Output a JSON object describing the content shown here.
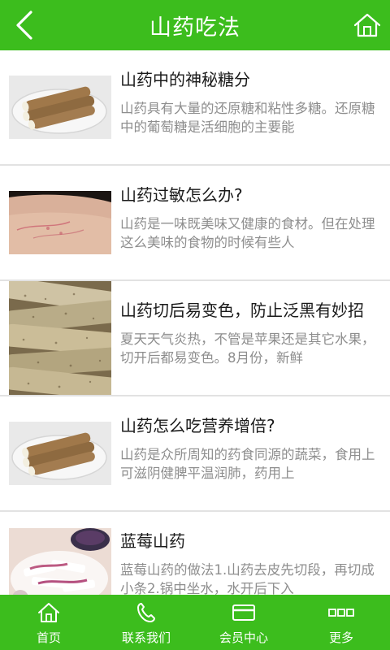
{
  "header": {
    "title": "山药吃法",
    "back_icon": "chevron-left-icon",
    "home_icon": "home-icon"
  },
  "colors": {
    "brand_green": "#3cbd1d",
    "title_text": "#1a1a1a",
    "desc_text": "#8e8e8e",
    "divider": "#e2e2e2"
  },
  "articles": [
    {
      "title": "山药中的神秘糖分",
      "desc": "山药具有大量的还原糖和粘性多糖。还原糖中的葡萄糖是活细胞的主要能",
      "image": "yam-on-plate"
    },
    {
      "title": "山药过敏怎么办?",
      "desc": "山药是一味既美味又健康的食材。但在处理这么美味的食物的时候有些人",
      "image": "allergic-skin"
    },
    {
      "title": "山药切后易变色，防止泛黑有妙招",
      "desc": "夏天天气炎热，不管是苹果还是其它水果，切开后都易变色。8月份，新鲜",
      "image": "yam-pile"
    },
    {
      "title": "山药怎么吃营养增倍?",
      "desc": "山药是众所周知的药食同源的蔬菜，食用上可滋阴健脾平温润肺，药用上",
      "image": "yam-on-plate"
    },
    {
      "title": "蓝莓山药",
      "desc": "蓝莓山药的做法1.山药去皮先切段，再切成小条2.锅中坐水，水开后下入",
      "image": "blueberry-yam-dish"
    }
  ],
  "bottom_nav": [
    {
      "label": "首页",
      "icon": "home-icon"
    },
    {
      "label": "联系我们",
      "icon": "phone-icon"
    },
    {
      "label": "会员中心",
      "icon": "card-icon"
    },
    {
      "label": "更多",
      "icon": "more-icon"
    }
  ]
}
